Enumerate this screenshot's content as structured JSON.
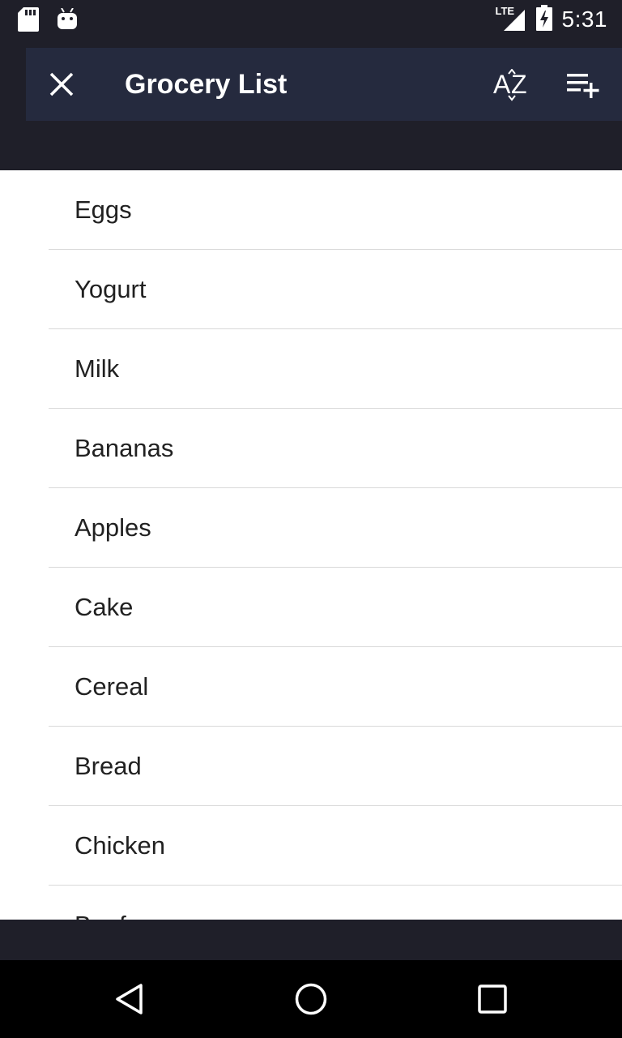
{
  "status_bar": {
    "network": "LTE",
    "time": "5:31"
  },
  "toolbar": {
    "title": "Grocery List",
    "icons": [
      "close-icon",
      "sort-az-icon",
      "playlist-add-icon"
    ]
  },
  "list": {
    "items": [
      {
        "label": "Eggs"
      },
      {
        "label": "Yogurt"
      },
      {
        "label": "Milk"
      },
      {
        "label": "Bananas"
      },
      {
        "label": "Apples"
      },
      {
        "label": "Cake"
      },
      {
        "label": "Cereal"
      },
      {
        "label": "Bread"
      },
      {
        "label": "Chicken"
      },
      {
        "label": "Beef"
      }
    ]
  },
  "colors": {
    "status_bar_bg": "#1f1f29",
    "toolbar_bg": "#252a3e",
    "list_bg": "#ffffff",
    "divider": "#d9d9d9",
    "nav_bar_bg": "#000000"
  }
}
